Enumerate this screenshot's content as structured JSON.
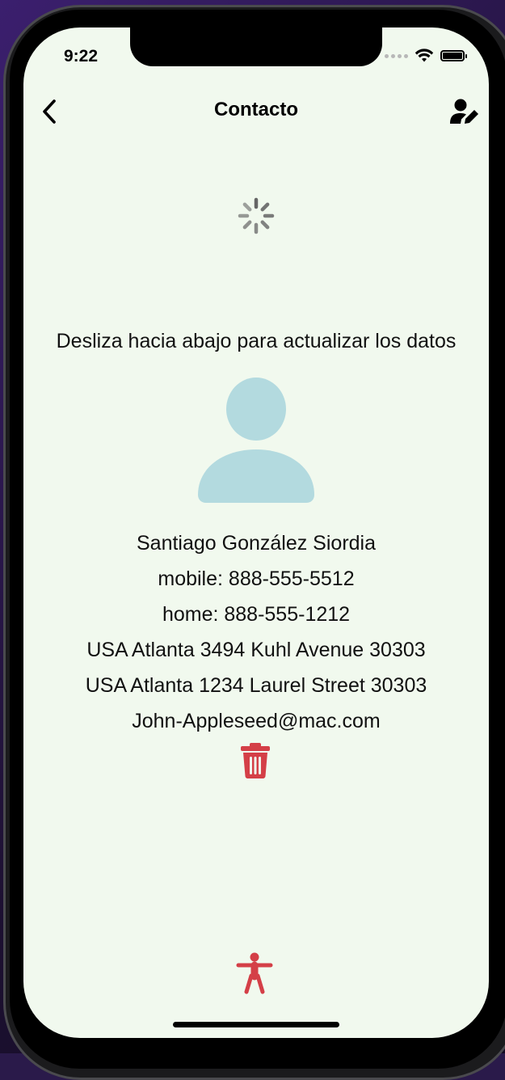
{
  "status_bar": {
    "time": "9:22"
  },
  "nav": {
    "title": "Contacto"
  },
  "hint": "Desliza hacia abajo para actualizar los datos",
  "contact": {
    "name": "Santiago González Siordia",
    "mobile": "mobile: 888-555-5512",
    "home": "home: 888-555-1212",
    "address1": "USA Atlanta 3494 Kuhl Avenue 30303",
    "address2": "USA Atlanta 1234 Laurel Street 30303",
    "email": "John-Appleseed@mac.com"
  },
  "colors": {
    "screen_bg": "#f1f9ee",
    "avatar": "#b3dadf",
    "danger": "#d43f47",
    "spinner": "#666666"
  },
  "icons": {
    "back": "chevron-left-icon",
    "edit": "user-edit-icon",
    "spinner": "activity-spinner-icon",
    "avatar": "person-avatar-icon",
    "delete": "trash-icon",
    "accessibility": "accessibility-icon"
  }
}
